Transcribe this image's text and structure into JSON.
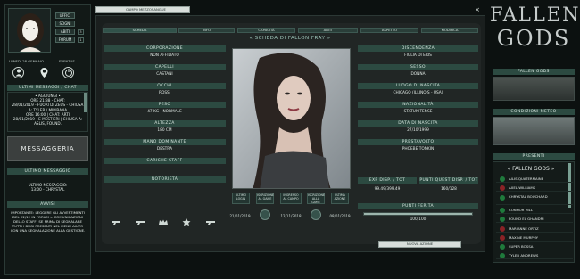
{
  "left": {
    "nav_buttons": [
      "UFFICI",
      "SOGNI",
      "ABITI",
      "FORUM"
    ],
    "nav_badges": [
      "3",
      "1"
    ],
    "location": "LUNEDI 28 GENNAIO",
    "weather": "EVENTUS",
    "chat_panel_title": "ULTIMI MESSAGGI / CHAT",
    "chat_lines": [
      "• AGGIUNGI •",
      "ORE 21:38 - CHAT:",
      "28/01/2019 - FUORI DI ZEUS - CHIUSA",
      "A: TYLER / MIRIBANA",
      "ORE 16:00 | CHAT: ARTI",
      "28/01/2019 - E MESTIERI | CHIUSA A:",
      "ASLIS, FOUND."
    ],
    "messaggeria": "MESSAGGERIA",
    "last_message_title": "ULTIMO MESSAGGIO",
    "last_message_lines": [
      "ULTIMO MESSAGGIO:",
      "13:00 - CHRYSTAL"
    ],
    "notice_title": "AVVISI",
    "notice_text": "IMPORTANTE: LEGGERE GLI AVVERTIMENTI DEL 22/12 IN FORUM > COMUNICAZIONI DELLO STAFF! SE PRIMA DI SEGNALARE TUTTI I BUGI PRESENTI NEL MENU AIUTO CON UNA SEGNALAZIONE ALLA GESTIONE."
  },
  "main": {
    "header_label": "CAMPO MEZZOSANGUE",
    "close_icon": "×",
    "tabs": [
      "SCHEDA",
      "INFO",
      "CAPACITÀ",
      "ABITI",
      "ASPETTO",
      "MODIFICA"
    ],
    "title": "« SCHEDA DI FALLON FRAY »",
    "left_fields": [
      {
        "label": "CORPORAZIONE",
        "value": "NON AFFILIATO"
      },
      {
        "label": "CAPELLI",
        "value": "CASTANI"
      },
      {
        "label": "OCCHI",
        "value": "ROSSI"
      },
      {
        "label": "PESO",
        "value": "47 KG - NORMALE"
      },
      {
        "label": "ALTEZZA",
        "value": "180 CM"
      },
      {
        "label": "MANO DOMINANTE",
        "value": "DESTRA"
      },
      {
        "label": "CARICHE STAFF",
        "value": ""
      },
      {
        "label": "NOTORIETÀ",
        "value": ""
      }
    ],
    "right_fields": [
      {
        "label": "DISCENDENZA",
        "value": "FIGLIA DI ERIS"
      },
      {
        "label": "SESSO",
        "value": "DONNA"
      },
      {
        "label": "LUOGO DI NASCITA",
        "value": "CHICAGO (ILLINOIS - USA)"
      },
      {
        "label": "NAZIONALITÀ",
        "value": "STATUNITENSE"
      },
      {
        "label": "DATA DI NASCITA",
        "value": "27/10/1999"
      },
      {
        "label": "PRESTAVOLTO",
        "value": "PHOEBE TONKIN"
      }
    ],
    "exp_labels": [
      "EXP DISP. / TOT",
      "PUNTI QUEST DISP. / TOT"
    ],
    "exp_values": [
      "99.49/399.49",
      "160/128"
    ],
    "health_label": "PUNTI FERITA",
    "health_value": "100/100",
    "health_fraction": 1.0,
    "stats_buttons": [
      "ULTIMO LOGIN",
      "ISCRIZIONE AL GAME",
      "INGRESSO AL CAMPO",
      "ISCRIZIONE ALLA GAME",
      "ULTIMA AZIONE"
    ],
    "stats_dates": [
      "21/01/2019",
      "12/11/2018",
      "08/01/2019"
    ],
    "footer_link": "NUOVA AZIONE"
  },
  "right": {
    "logo_line1": "FALLEN",
    "logo_line2": "GODS",
    "section1": "FALLEN GODS",
    "section2": "CONDIZIONI METEO",
    "online_title": "PRESENTI",
    "online_header": "« FALLEN GODS »",
    "online": [
      {
        "name": "AILIS QUATERMAINE",
        "status": "green"
      },
      {
        "name": "AXEL WILLIAMS",
        "status": "red"
      },
      {
        "name": "CHRYSTAL BOUCHARD",
        "status": "green"
      },
      {
        "name": "CONNOR HILL",
        "status": "green"
      },
      {
        "name": "FOUND EL GHANDRI",
        "status": "green"
      },
      {
        "name": "MARIANNE ORTIZ",
        "status": "red"
      },
      {
        "name": "MAXINE MURPHY",
        "status": "red"
      },
      {
        "name": "SUPER BOSSA",
        "status": "green"
      },
      {
        "name": "TYLER ANDREWS",
        "status": "green"
      }
    ]
  }
}
